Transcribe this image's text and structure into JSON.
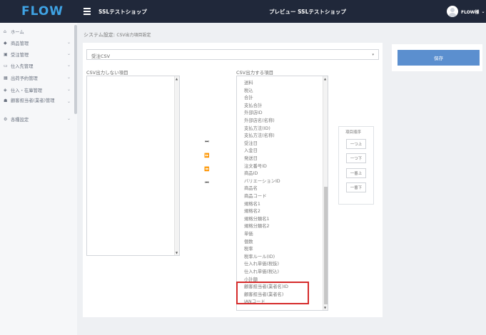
{
  "header": {
    "logo": "FLOW",
    "shop_name": "SSLテストショップ",
    "preview_label": "プレビュー SSLテストショップ",
    "user_name": "FLOW様"
  },
  "sidebar": {
    "items": [
      {
        "icon": "home-icon",
        "label": "ホーム",
        "chevron": false
      },
      {
        "icon": "tag-icon",
        "label": "商品管理",
        "chevron": true
      },
      {
        "icon": "cart-icon",
        "label": "受注管理",
        "chevron": true
      },
      {
        "icon": "truck-icon",
        "label": "仕入先管理",
        "chevron": true
      },
      {
        "icon": "calendar-icon",
        "label": "出荷予約管理",
        "chevron": true
      },
      {
        "icon": "box-icon",
        "label": "仕入・在庫管理",
        "chevron": true
      },
      {
        "icon": "user-icon",
        "label": "顧客担当者(業者)管理",
        "chevron": true
      },
      {
        "icon": "gear-icon",
        "label": "各種設定",
        "chevron": true
      }
    ]
  },
  "breadcrumb": {
    "section": "システム設定",
    "page": "CSV出力項目設定"
  },
  "csv_select": {
    "value": "受注CSV",
    "arrow": "▾"
  },
  "left_list": {
    "label": "CSV出力しない項目",
    "items": []
  },
  "right_list": {
    "label": "CSV出力する項目",
    "items": [
      "送料",
      "税込",
      "合計",
      "支払合計",
      "外部店ID",
      "外部店名(名称)",
      "支払方法(ID)",
      "支払方法(名称)",
      "受注日",
      "入金日",
      "発送日",
      "注文番号ID",
      "商品ID",
      "バリエーションID",
      "商品名",
      "商品コード",
      "規格名1",
      "規格名2",
      "規格分類名1",
      "規格分類名2",
      "単価",
      "個数",
      "税率",
      "税率ルール(ID)",
      "仕入れ単価(税抜)",
      "仕入れ単価(税込)",
      "小計額",
      "顧客担当者(業者名)ID",
      "顧客担当者(業者名)",
      "JANコード"
    ]
  },
  "move_buttons": [
    {
      "name": "move-all-right-button",
      "glyph": "⏭"
    },
    {
      "name": "move-right-button",
      "glyph": "⏩"
    },
    {
      "name": "move-left-button",
      "glyph": "⏪"
    },
    {
      "name": "move-all-left-button",
      "glyph": "⏮"
    }
  ],
  "order_panel": {
    "title": "項目順序",
    "buttons": [
      "一つ上",
      "一つ下",
      "一番上",
      "一番下"
    ]
  },
  "save_button_label": "保存",
  "colors": {
    "topbar": "#20283a",
    "logo": "#3fa3e4",
    "primary": "#5b8fcf",
    "highlight": "#d52b2b"
  }
}
